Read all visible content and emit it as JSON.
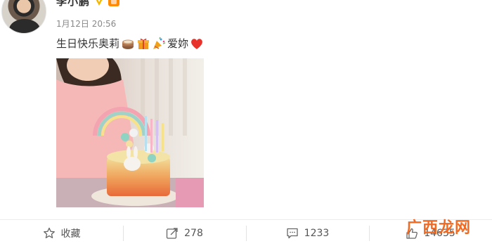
{
  "post": {
    "username": "李小鹏",
    "timestamp": "1月12日 20:56",
    "text_segments": {
      "greeting": "生日快乐奥莉",
      "love": "爱妳"
    },
    "emojis": [
      "cake-icon",
      "gift-icon",
      "party-popper-icon",
      "heart-icon"
    ]
  },
  "actions": {
    "favorite_label": "收藏",
    "repost_count": "278",
    "comment_count": "1233",
    "like_count": "14635"
  },
  "watermark": {
    "text": "广西龙网"
  },
  "colors": {
    "accent": "#f06a24",
    "heart": "#e8322c",
    "text": "#333333",
    "muted": "#888888"
  }
}
